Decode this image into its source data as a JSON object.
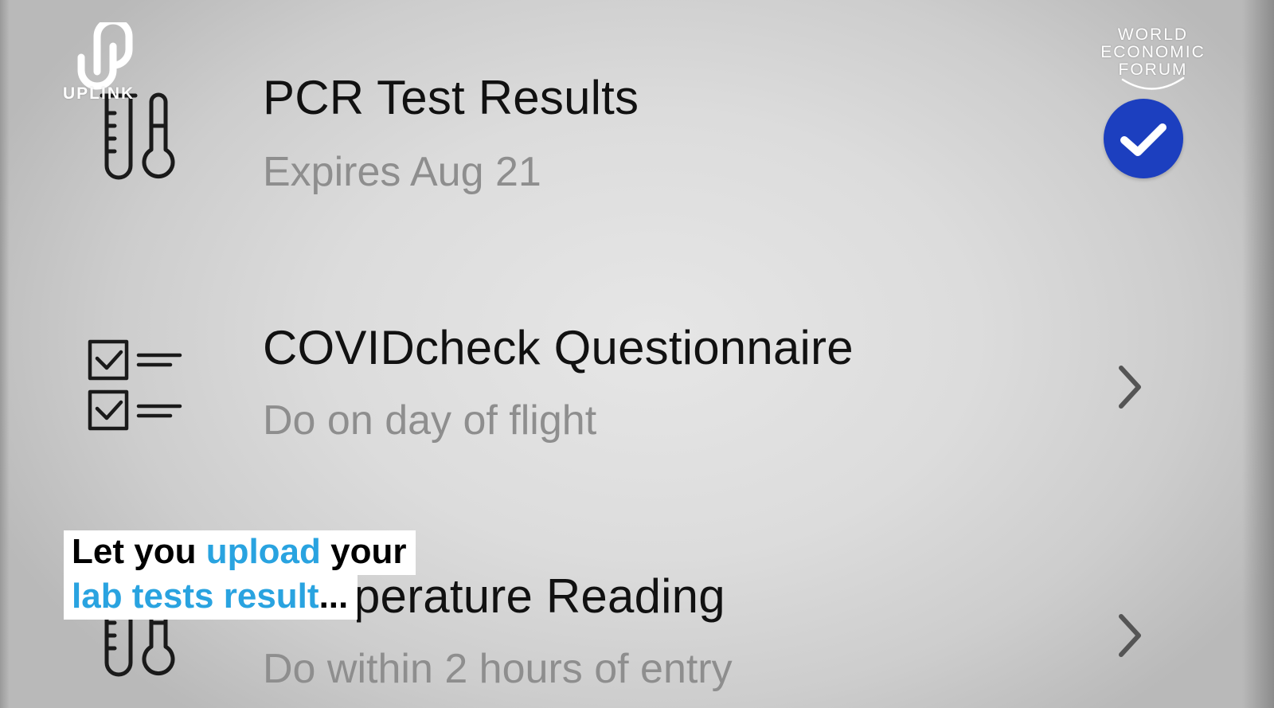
{
  "branding": {
    "left_logo_text": "UPLINK",
    "right_logo_lines": [
      "WORLD",
      "ECONOMIC",
      "FORUM"
    ]
  },
  "items": [
    {
      "title": "PCR Test Results",
      "subtitle": "Expires Aug 21",
      "icon": "test-tubes-icon",
      "status": "completed"
    },
    {
      "title": "COVIDcheck Questionnaire",
      "subtitle": "Do on day of flight",
      "icon": "checklist-icon",
      "status": "pending"
    },
    {
      "title": "Temperature Reading",
      "subtitle": "Do within 2 hours of entry",
      "icon": "test-tubes-icon",
      "status": "pending"
    }
  ],
  "caption": {
    "line1": {
      "part1": "Let you ",
      "part2": "upload",
      "part3": " your"
    },
    "line2": {
      "part1": "lab tests result",
      "part2": "..."
    }
  },
  "colors": {
    "accent": "#1c3fbf",
    "caption_highlight": "#29a3e0",
    "subtitle_gray": "#8e8e8e"
  }
}
